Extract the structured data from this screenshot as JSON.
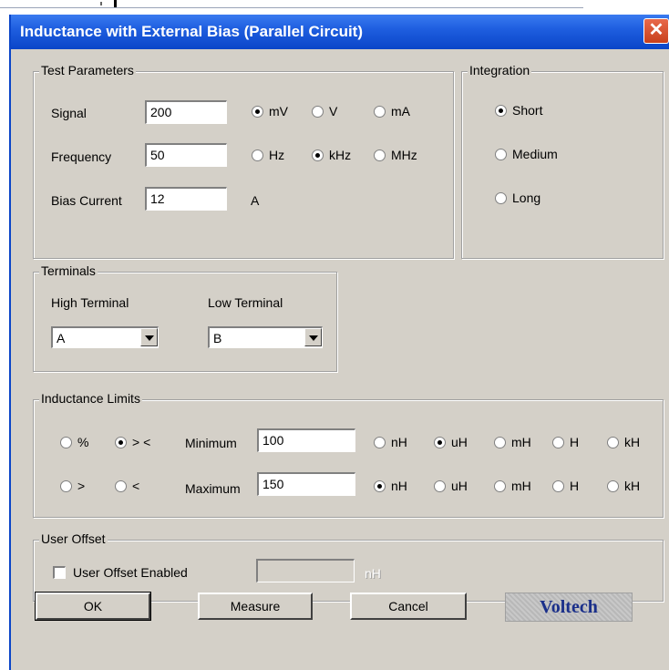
{
  "window": {
    "title": "Inductance with External Bias (Parallel Circuit)",
    "close_glyph": "✕"
  },
  "test_parameters": {
    "label": "Test Parameters",
    "signal": {
      "label": "Signal",
      "value": "200",
      "units": [
        {
          "label": "mV",
          "selected": true
        },
        {
          "label": "V",
          "selected": false
        },
        {
          "label": "mA",
          "selected": false
        }
      ]
    },
    "frequency": {
      "label": "Frequency",
      "value": "50",
      "units": [
        {
          "label": "Hz",
          "selected": false
        },
        {
          "label": "kHz",
          "selected": true
        },
        {
          "label": "MHz",
          "selected": false
        }
      ]
    },
    "bias": {
      "label": "Bias Current",
      "value": "12",
      "unit": "A"
    }
  },
  "integration": {
    "label": "Integration",
    "options": [
      {
        "label": "Short",
        "selected": true
      },
      {
        "label": "Medium",
        "selected": false
      },
      {
        "label": "Long",
        "selected": false
      }
    ]
  },
  "terminals": {
    "label": "Terminals",
    "high": {
      "label": "High Terminal",
      "value": "A"
    },
    "low": {
      "label": "Low Terminal",
      "value": "B"
    }
  },
  "limits": {
    "label": "Inductance Limits",
    "mode_row1": [
      {
        "label": "%",
        "selected": false
      },
      {
        "label": "> <",
        "selected": true
      }
    ],
    "mode_row2": [
      {
        "label": ">",
        "selected": false
      },
      {
        "label": "<",
        "selected": false
      }
    ],
    "minimum": {
      "label": "Minimum",
      "value": "100",
      "units": [
        {
          "label": "nH",
          "selected": false
        },
        {
          "label": "uH",
          "selected": true
        },
        {
          "label": "mH",
          "selected": false
        },
        {
          "label": "H",
          "selected": false
        },
        {
          "label": "kH",
          "selected": false
        }
      ]
    },
    "maximum": {
      "label": "Maximum",
      "value": "150",
      "units": [
        {
          "label": "nH",
          "selected": true
        },
        {
          "label": "uH",
          "selected": false
        },
        {
          "label": "mH",
          "selected": false
        },
        {
          "label": "H",
          "selected": false
        },
        {
          "label": "kH",
          "selected": false
        }
      ]
    }
  },
  "user_offset": {
    "label": "User Offset",
    "checkbox_label": "User Offset Enabled",
    "checked": false,
    "value": "",
    "unit": "nH"
  },
  "buttons": {
    "ok": "OK",
    "measure": "Measure",
    "cancel": "Cancel"
  },
  "logo": {
    "text": "Voltech"
  }
}
